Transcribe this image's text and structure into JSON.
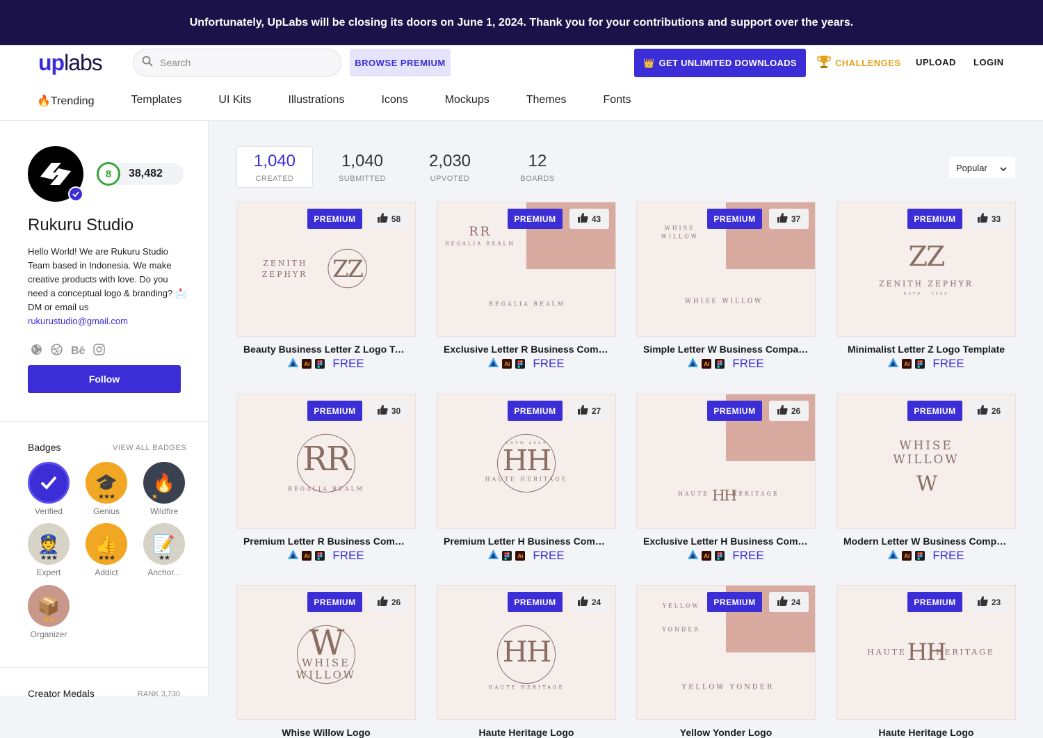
{
  "banner": {
    "text": "Unfortunately, UpLabs will be closing its doors on June 1, 2024. Thank you for your contributions and support over the years."
  },
  "header": {
    "logo_up": "up",
    "logo_labs": "labs",
    "search_placeholder": "Search",
    "browse_premium": "BROWSE PREMIUM",
    "get_unlimited": "GET UNLIMITED DOWNLOADS",
    "challenges": "CHALLENGES",
    "upload": "UPLOAD",
    "login": "LOGIN"
  },
  "nav": [
    "🔥Trending",
    "Templates",
    "UI Kits",
    "Illustrations",
    "Icons",
    "Mockups",
    "Themes",
    "Fonts"
  ],
  "profile": {
    "level": "8",
    "points": "38,482",
    "name": "Rukuru Studio",
    "bio": "Hello World! We are Rukuru Studio Team based in Indonesia. We make creative products with love. Do you need a conceptual logo & branding? 📩 DM or email us",
    "email": "rukurustudio@gmail.com",
    "follow": "Follow",
    "socials": [
      "globe-icon",
      "dribbble-icon",
      "behance-icon",
      "instagram-icon"
    ],
    "behance_text": "Bē"
  },
  "badges": {
    "title": "Badges",
    "view_all": "VIEW ALL BADGES",
    "items": [
      {
        "label": "Verified",
        "glyph": "✓",
        "stars": ""
      },
      {
        "label": "Genius",
        "glyph": "🎓",
        "stars": "★★★"
      },
      {
        "label": "Wildfire",
        "glyph": "🔥",
        "stars": "★"
      },
      {
        "label": "Expert",
        "glyph": "👮",
        "stars": "★★★"
      },
      {
        "label": "Addict",
        "glyph": "👍",
        "stars": "★★★"
      },
      {
        "label": "Anchor...",
        "glyph": "📝",
        "stars": "★★"
      },
      {
        "label": "Organizer",
        "glyph": "📦",
        "stars": "★★"
      }
    ]
  },
  "medals": {
    "title": "Creator Medals",
    "rank": "RANK 3,730"
  },
  "stats": [
    {
      "value": "1,040",
      "label": "CREATED"
    },
    {
      "value": "1,040",
      "label": "SUBMITTED"
    },
    {
      "value": "2,030",
      "label": "UPVOTED"
    },
    {
      "value": "12",
      "label": "BOARDS"
    }
  ],
  "sort": {
    "selected": "Popular"
  },
  "premium_label": "PREMIUM",
  "free_label": "FREE",
  "cards": [
    {
      "title": "Beauty Business Letter Z Logo Template",
      "likes": "58",
      "art": [
        "ZENITH",
        "ZEPHYR",
        "ZZ"
      ]
    },
    {
      "title": "Exclusive Letter R Business Company Logo",
      "likes": "43",
      "art": [
        "REGALIA REALM",
        "RR",
        "REGALIA REALM"
      ]
    },
    {
      "title": "Simple Letter W Business Company Logo",
      "likes": "37",
      "art": [
        "WHISE",
        "WILLOW",
        "WHISE   WILLOW"
      ]
    },
    {
      "title": "Minimalist Letter Z Logo Template",
      "likes": "33",
      "art": [
        "ZZ",
        "ZENITH ZEPHYR",
        "ESTD · 2024"
      ]
    },
    {
      "title": "Premium Letter R Business Company Logo",
      "likes": "30",
      "art": [
        "RR",
        "REGALIA REALM",
        ""
      ]
    },
    {
      "title": "Premium Letter H Business Company Logo",
      "likes": "27",
      "art": [
        "HH",
        "HAUTE HERITAGE",
        "ESTD   2024"
      ]
    },
    {
      "title": "Exclusive Letter H Business Company Logo",
      "likes": "26",
      "art": [
        "HH",
        "HAUTE",
        "HERITAGE"
      ]
    },
    {
      "title": "Modern Letter W Business Company Logo",
      "likes": "26",
      "art": [
        "WHISE",
        "WILLOW",
        "W"
      ]
    },
    {
      "title": "Whise Willow Logo",
      "likes": "26",
      "art": [
        "W",
        "WHISE",
        "WILLOW"
      ]
    },
    {
      "title": "Haute Heritage Logo",
      "likes": "24",
      "art": [
        "HH",
        "HAUTE HERITAGE",
        ""
      ]
    },
    {
      "title": "Yellow Yonder Logo",
      "likes": "24",
      "art": [
        "YELLOW",
        "YONDER",
        "YELLOW YONDER"
      ]
    },
    {
      "title": "Haute Heritage Logo",
      "likes": "23",
      "art": [
        "HAUTE",
        "HH",
        "HERITAGE"
      ]
    }
  ],
  "card_tools": [
    [
      "affinity-icon",
      "illustrator-icon",
      "figma-icon"
    ],
    [
      "affinity-icon",
      "illustrator-icon",
      "figma-icon"
    ],
    [
      "affinity-icon",
      "illustrator-icon",
      "figma-icon"
    ],
    [
      "affinity-icon",
      "illustrator-icon",
      "figma-icon"
    ],
    [
      "affinity-icon",
      "illustrator-icon",
      "figma-icon"
    ],
    [
      "affinity-icon",
      "figma-icon",
      "illustrator-icon"
    ],
    [
      "affinity-icon",
      "illustrator-icon",
      "figma-icon"
    ],
    [
      "affinity-icon",
      "illustrator-icon",
      "figma-icon"
    ]
  ],
  "illustrator_text": "Ai",
  "colors": {
    "brand": "#3b2ed6",
    "banner": "#1b1249",
    "thumb_bg": "#f5eeeb",
    "thumb_pink": "#d9aaa0",
    "logo_ink": "#8a6e64"
  }
}
